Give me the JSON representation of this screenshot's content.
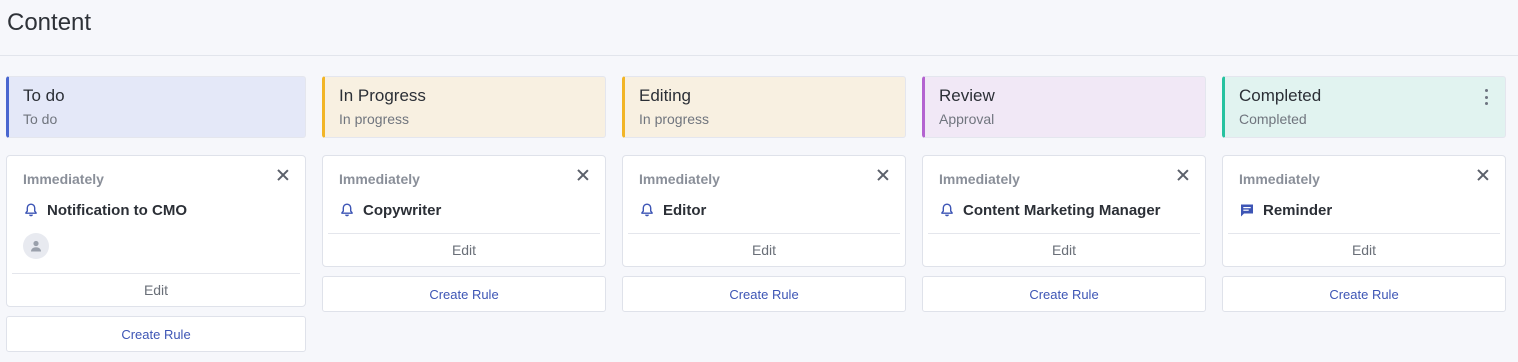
{
  "page": {
    "title": "Content"
  },
  "columns": [
    {
      "title": "To do",
      "subtitle": "To do",
      "accent": "#4a67d0",
      "bg": "#e4e8f8",
      "card": {
        "when": "Immediately",
        "action_icon": "bell-icon",
        "action": "Notification to CMO",
        "has_avatar": true,
        "avatar_icon": "user-icon",
        "edit": "Edit"
      },
      "create_rule": "Create Rule"
    },
    {
      "title": "In Progress",
      "subtitle": "In progress",
      "accent": "#f2b527",
      "bg": "#f8f0e1",
      "card": {
        "when": "Immediately",
        "action_icon": "bell-icon",
        "action": "Copywriter",
        "edit": "Edit"
      },
      "create_rule": "Create Rule"
    },
    {
      "title": "Editing",
      "subtitle": "In progress",
      "accent": "#f2b527",
      "bg": "#f8f0e1",
      "card": {
        "when": "Immediately",
        "action_icon": "bell-icon",
        "action": "Editor",
        "edit": "Edit"
      },
      "create_rule": "Create Rule"
    },
    {
      "title": "Review",
      "subtitle": "Approval",
      "accent": "#b463d0",
      "bg": "#f1e8f6",
      "card": {
        "when": "Immediately",
        "action_icon": "bell-icon",
        "action": "Content Marketing Manager",
        "edit": "Edit"
      },
      "create_rule": "Create Rule"
    },
    {
      "title": "Completed",
      "subtitle": "Completed",
      "accent": "#27c2a0",
      "bg": "#e1f3f0",
      "has_menu": true,
      "menu_icon": "more-vertical-icon",
      "card": {
        "when": "Immediately",
        "action_icon": "message-icon",
        "action": "Reminder",
        "edit": "Edit"
      },
      "create_rule": "Create Rule"
    }
  ]
}
